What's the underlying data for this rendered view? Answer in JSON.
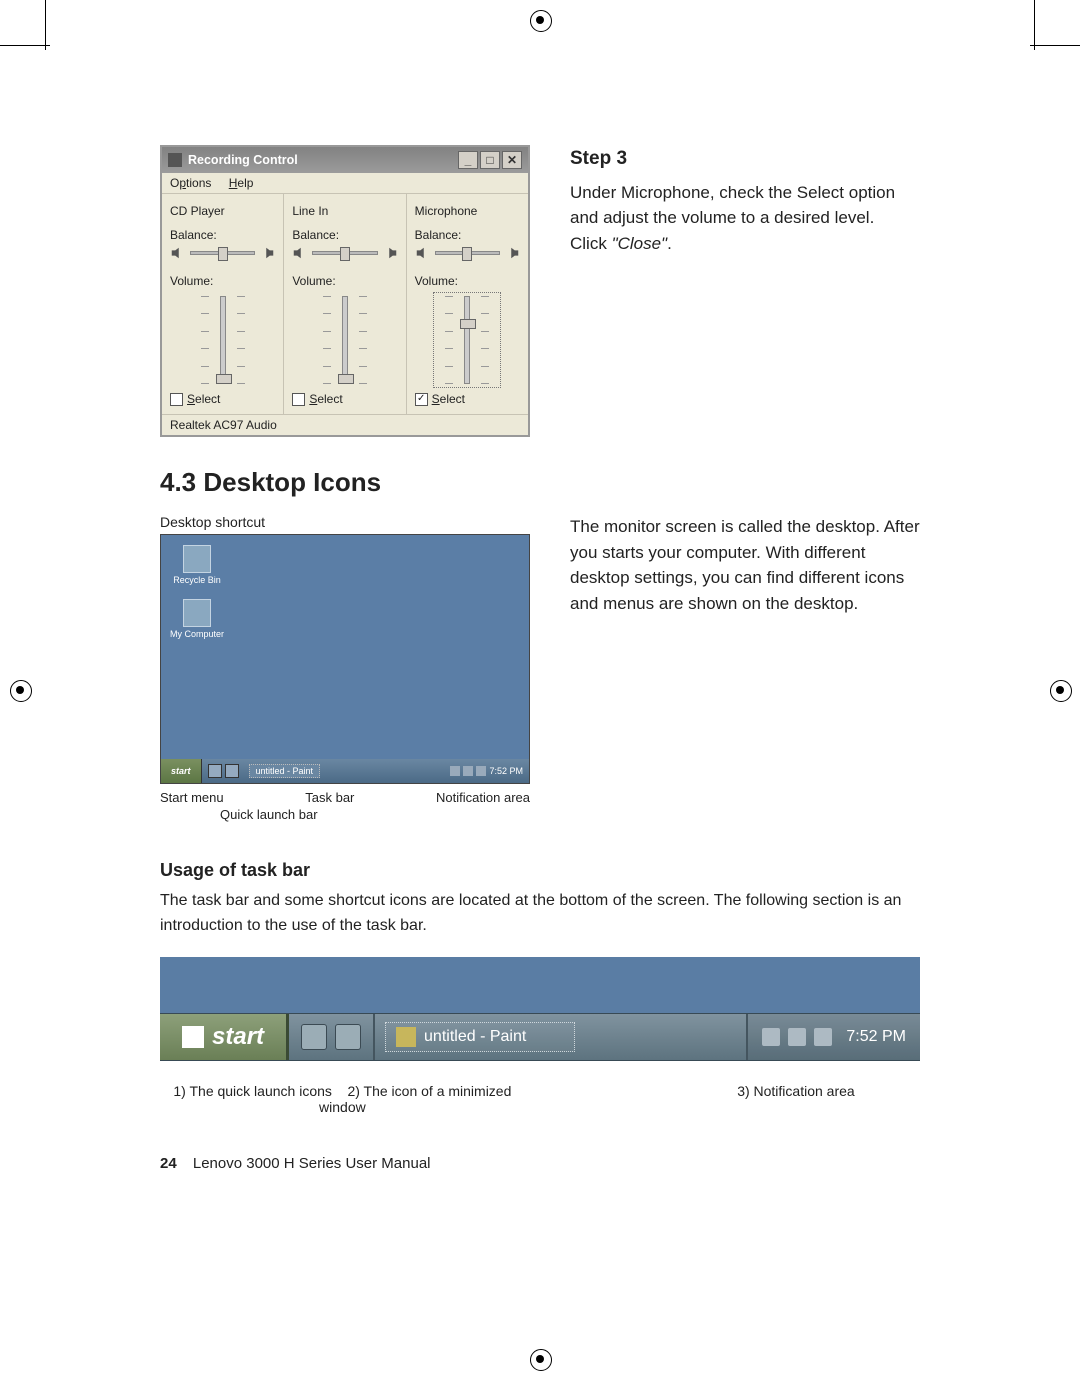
{
  "step3": {
    "heading": "Step 3",
    "body1": "Under Microphone, check the Select option and adjust the volume to a desired level.",
    "body2_prefix": "Click ",
    "body2_close": "\"Close\"",
    "body2_suffix": "."
  },
  "recording_window": {
    "title": "Recording Control",
    "menu_options": "Options",
    "menu_help": "Help",
    "channels": [
      {
        "name": "CD Player",
        "balance_label": "Balance:",
        "volume_label": "Volume:",
        "select_label": "Select",
        "selected": false,
        "vol_thumb_pct": 88
      },
      {
        "name": "Line In",
        "balance_label": "Balance:",
        "volume_label": "Volume:",
        "select_label": "Select",
        "selected": false,
        "vol_thumb_pct": 88
      },
      {
        "name": "Microphone",
        "balance_label": "Balance:",
        "volume_label": "Volume:",
        "select_label": "Select",
        "selected": true,
        "vol_thumb_pct": 28
      }
    ],
    "status": "Realtek AC97 Audio"
  },
  "section_heading": "4.3 Desktop Icons",
  "desktop_block": {
    "caption_top": "Desktop shortcut",
    "icons": [
      {
        "label": "Recycle Bin"
      },
      {
        "label": "My Computer"
      }
    ],
    "start": "start",
    "task_label": "untitled - Paint",
    "clock": "7:52 PM",
    "callout_start": "Start menu",
    "callout_task": "Task bar",
    "callout_tray": "Notification area",
    "callout_ql": "Quick launch bar"
  },
  "desktop_para": "The monitor screen is called the desktop. After you starts your computer. With different desktop settings, you can find different icons and menus are shown on the desktop.",
  "taskbar_section": {
    "heading": "Usage of task bar",
    "para": "The task bar and some shortcut icons are located at the bottom of the screen. The following section is an introduction to the use of the task bar.",
    "start": "start",
    "task_label": "untitled - Paint",
    "clock": "7:52 PM",
    "callout1": "1) The quick launch icons",
    "callout2": "2) The icon of a minimized window",
    "callout3": "3) Notification area"
  },
  "footer": {
    "page": "24",
    "title": "Lenovo 3000 H Series User Manual"
  }
}
